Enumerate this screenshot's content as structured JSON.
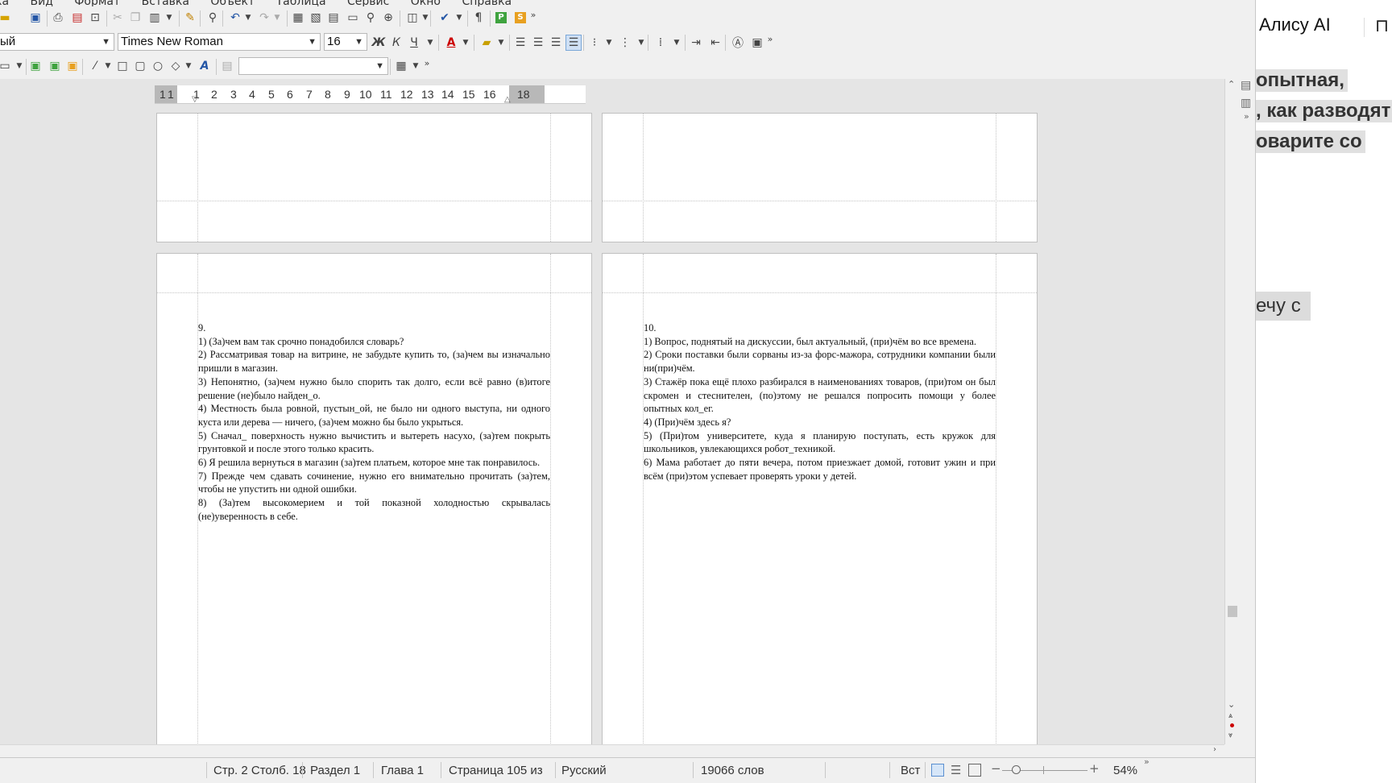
{
  "menu": [
    "ка",
    "Вид",
    "Формат",
    "Вставка",
    "Объект",
    "Таблица",
    "Сервис",
    "Окно",
    "Справка"
  ],
  "toolbar2": {
    "style_value": "ый",
    "font_name": "Times New Roman",
    "font_size": "16",
    "bold": "Ж",
    "italic": "К",
    "underline": "Ч",
    "font_color_glyph": "A"
  },
  "toolbar3": {
    "fontwork_glyph": "A",
    "find_value": ""
  },
  "ruler": {
    "labels": [
      "1",
      "1",
      "1",
      "2",
      "3",
      "4",
      "5",
      "6",
      "7",
      "8",
      "9",
      "10",
      "11",
      "12",
      "13",
      "14",
      "15",
      "16",
      "18"
    ]
  },
  "pages": {
    "left": {
      "lines": [
        "9.",
        "1) (За)чем вам так срочно понадобился словарь?",
        "2) Рассматривая товар на витрине, не забудьте купить то, (за)чем вы изначально пришли в магазин.",
        "3) Непонятно, (за)чем нужно было спорить так долго, если всё равно (в)итоге решение (не)было найден_о.",
        "4) Местность была ровной, пустын_ой, не было ни одного выступа, ни одного куста или дерева — ничего, (за)чем можно бы было укрыться.",
        "5) Сначал_ поверхность нужно вычистить и вытереть насухо, (за)тем покрыть грунтовкой и после этого только красить.",
        "6) Я решила вернуться в магазин (за)тем платьем, которое мне так понравилось.",
        "7) Прежде чем сдавать сочинение, нужно его внимательно прочитать (за)тем, чтобы не упустить ни одной ошибки.",
        "8) (За)тем высокомерием и той показной холодностью скрывалась (не)уверенность в себе."
      ]
    },
    "right": {
      "lines": [
        "10.",
        "1) Вопрос, поднятый на дискуссии, был актуальный, (при)чём во все времена.",
        "2) Сроки поставки были сорваны из-за форс-мажора, сотрудники компании были ни(при)чём.",
        "3) Стажёр пока ещё плохо разбирался в наименованиях товаров, (при)том он был скромен и стеснителен, (по)этому не решался попросить помощи у более опытных кол_ег.",
        "4) (При)чём здесь я?",
        "5) (При)том университете, куда я планирую поступать, есть кружок для школьников, увлекающихся робот_техникой.",
        "6) Мама работает до пяти вечера, потом приезжает домой, готовит ужин и при всём (при)этом успевает проверять уроки у детей."
      ]
    }
  },
  "statusbar": {
    "page_col": "Стр. 2 Столб. 18",
    "section": "Раздел 1",
    "chapter": "Глава 1",
    "page_of": "Страница 105 из",
    "language": "Русский",
    "word_count": "19066 слов",
    "insert_mode": "Вст",
    "zoom": "54%",
    "zoom_level": 0.54
  },
  "right_panel": {
    "title": "Алису AI",
    "line1": "опытная,",
    "line2": ", как разводят",
    "line3": "оварите со",
    "pill": "ечу с"
  },
  "colors": {
    "accent_green": "#3fa33f",
    "accent_orange": "#e8a020",
    "font_color_red": "#cc0000",
    "highlight_yellow": "#f2d600"
  }
}
